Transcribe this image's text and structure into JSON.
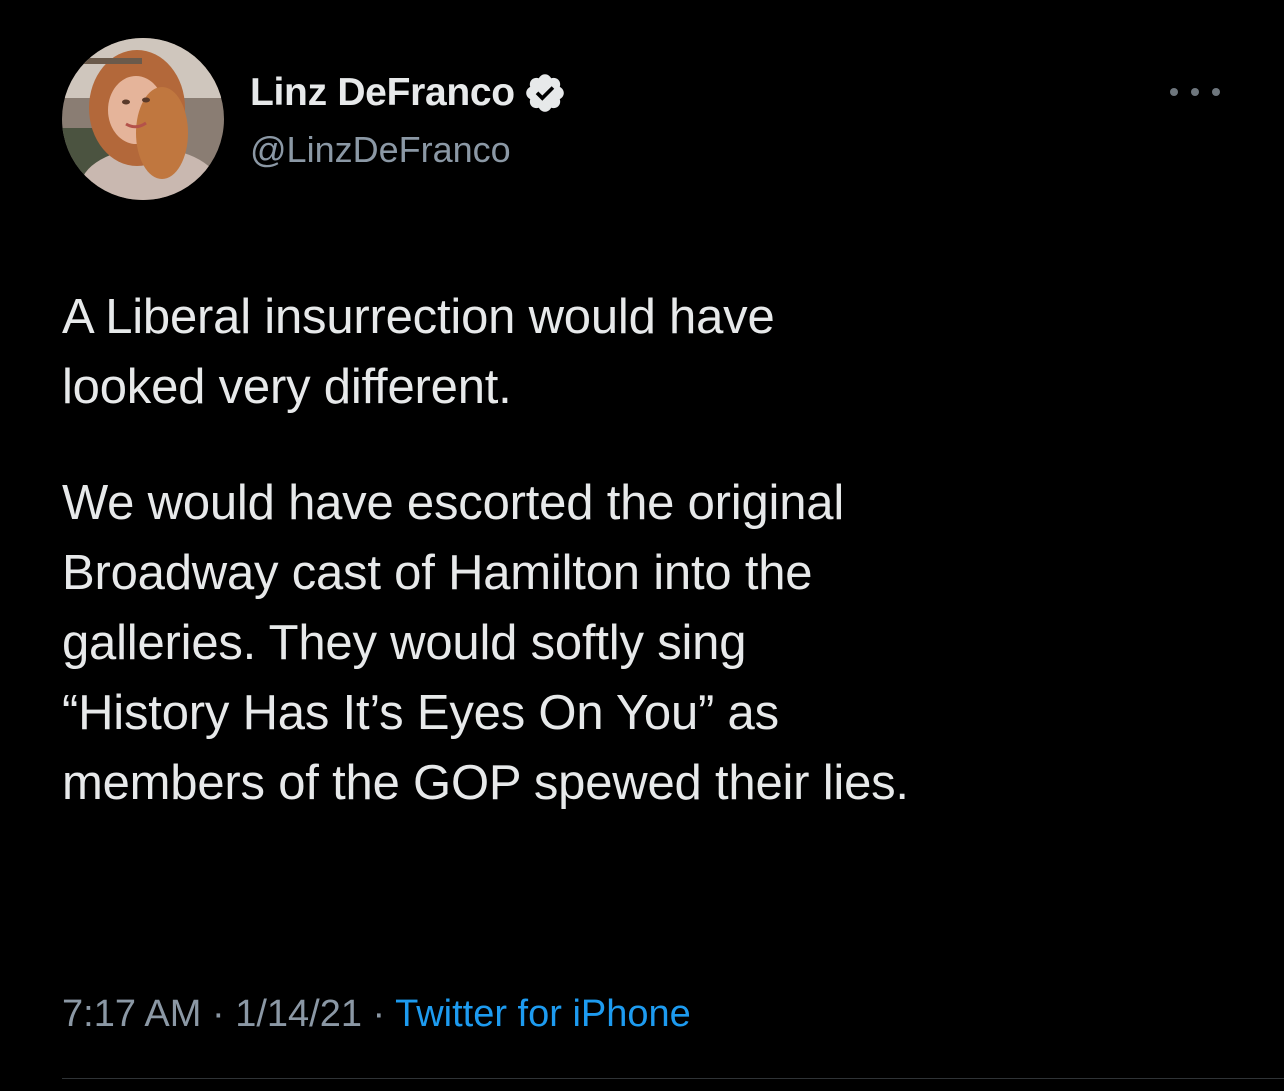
{
  "author": {
    "display_name": "Linz DeFranco",
    "handle": "@LinzDeFranco",
    "verified": true
  },
  "tweet": {
    "paragraphs": [
      "A Liberal insurrection would have\nlooked very different.",
      "We would have escorted the original\nBroadway cast of Hamilton into the\ngalleries. They would softly sing\n“History Has It’s Eyes On You” as\nmembers of the GOP spewed their lies."
    ]
  },
  "meta": {
    "time": "7:17 AM",
    "separator": " · ",
    "date": "1/14/21",
    "source": "Twitter for iPhone"
  },
  "icons": {
    "verified": "verified-badge-icon",
    "more": "more-options-icon"
  },
  "colors": {
    "background": "#000000",
    "text": "#e7e9ea",
    "secondary": "#8b98a5",
    "link": "#1d9bf0"
  }
}
